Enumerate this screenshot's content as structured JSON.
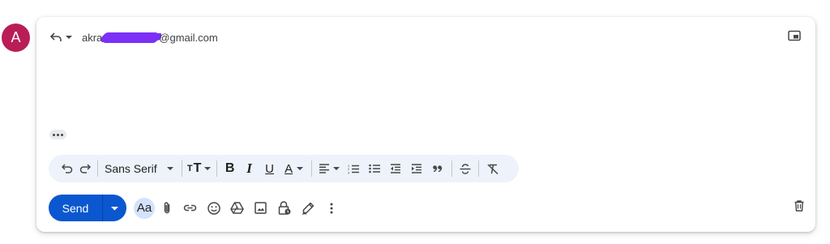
{
  "colors": {
    "avatar_bg": "#b91d56",
    "accent": "#0b57d0",
    "format_bar_bg": "#eef2fa"
  },
  "avatar": {
    "letter": "A"
  },
  "header": {
    "recipient_prefix": "akra",
    "recipient_suffix": "@gmail.com",
    "reply_icon": "reply-icon",
    "popout_icon": "pop-out-icon"
  },
  "format_toolbar": {
    "font_family": "Sans Serif",
    "bold": "B",
    "italic": "I",
    "underline": "U",
    "text_color": "A",
    "icons": [
      "undo-icon",
      "redo-icon",
      "font-size-icon",
      "align-icon",
      "numbered-list-icon",
      "bulleted-list-icon",
      "indent-less-icon",
      "indent-more-icon",
      "quote-icon",
      "strikethrough-icon",
      "remove-formatting-icon"
    ]
  },
  "bottom_toolbar": {
    "send_label": "Send",
    "formatting_label": "Aa",
    "icons": [
      "attach-icon",
      "link-icon",
      "emoji-icon",
      "drive-icon",
      "photo-icon",
      "confidential-icon",
      "signature-icon",
      "more-options-icon",
      "trash-icon"
    ]
  }
}
